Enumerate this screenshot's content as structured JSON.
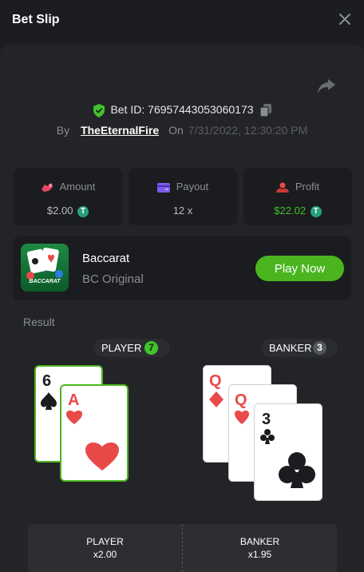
{
  "header": {
    "title": "Bet Slip"
  },
  "bet": {
    "id_label": "Bet ID: 76957443053060173",
    "by": "By",
    "user": "TheEternalFire",
    "on": "On",
    "date": "7/31/2022, 12:30:20 PM"
  },
  "stats": {
    "amount_label": "Amount",
    "amount_value": "$2.00",
    "payout_label": "Payout",
    "payout_value": "12 x",
    "profit_label": "Profit",
    "profit_value": "$22.02"
  },
  "game": {
    "name": "Baccarat",
    "subtitle": "BC Original",
    "thumb_text": "BACCARAT",
    "play_label": "Play Now"
  },
  "result": {
    "label": "Result",
    "player_label": "PLAYER",
    "player_score": "7",
    "banker_label": "BANKER",
    "banker_score": "3",
    "player_cards": [
      {
        "rank": "6",
        "suit": "spade"
      },
      {
        "rank": "A",
        "suit": "heart"
      }
    ],
    "banker_cards": [
      {
        "rank": "Q",
        "suit": "diamond"
      },
      {
        "rank": "Q",
        "suit": "heart"
      },
      {
        "rank": "3",
        "suit": "club"
      }
    ]
  },
  "odds": {
    "player_label": "PLAYER",
    "player_value": "x2.00",
    "banker_label": "BANKER",
    "banker_value": "x1.95"
  },
  "colors": {
    "accent_green": "#4ab51f",
    "player_green": "#3fc42a",
    "card_red": "#e84a4a",
    "card_black": "#1b1c1f"
  }
}
